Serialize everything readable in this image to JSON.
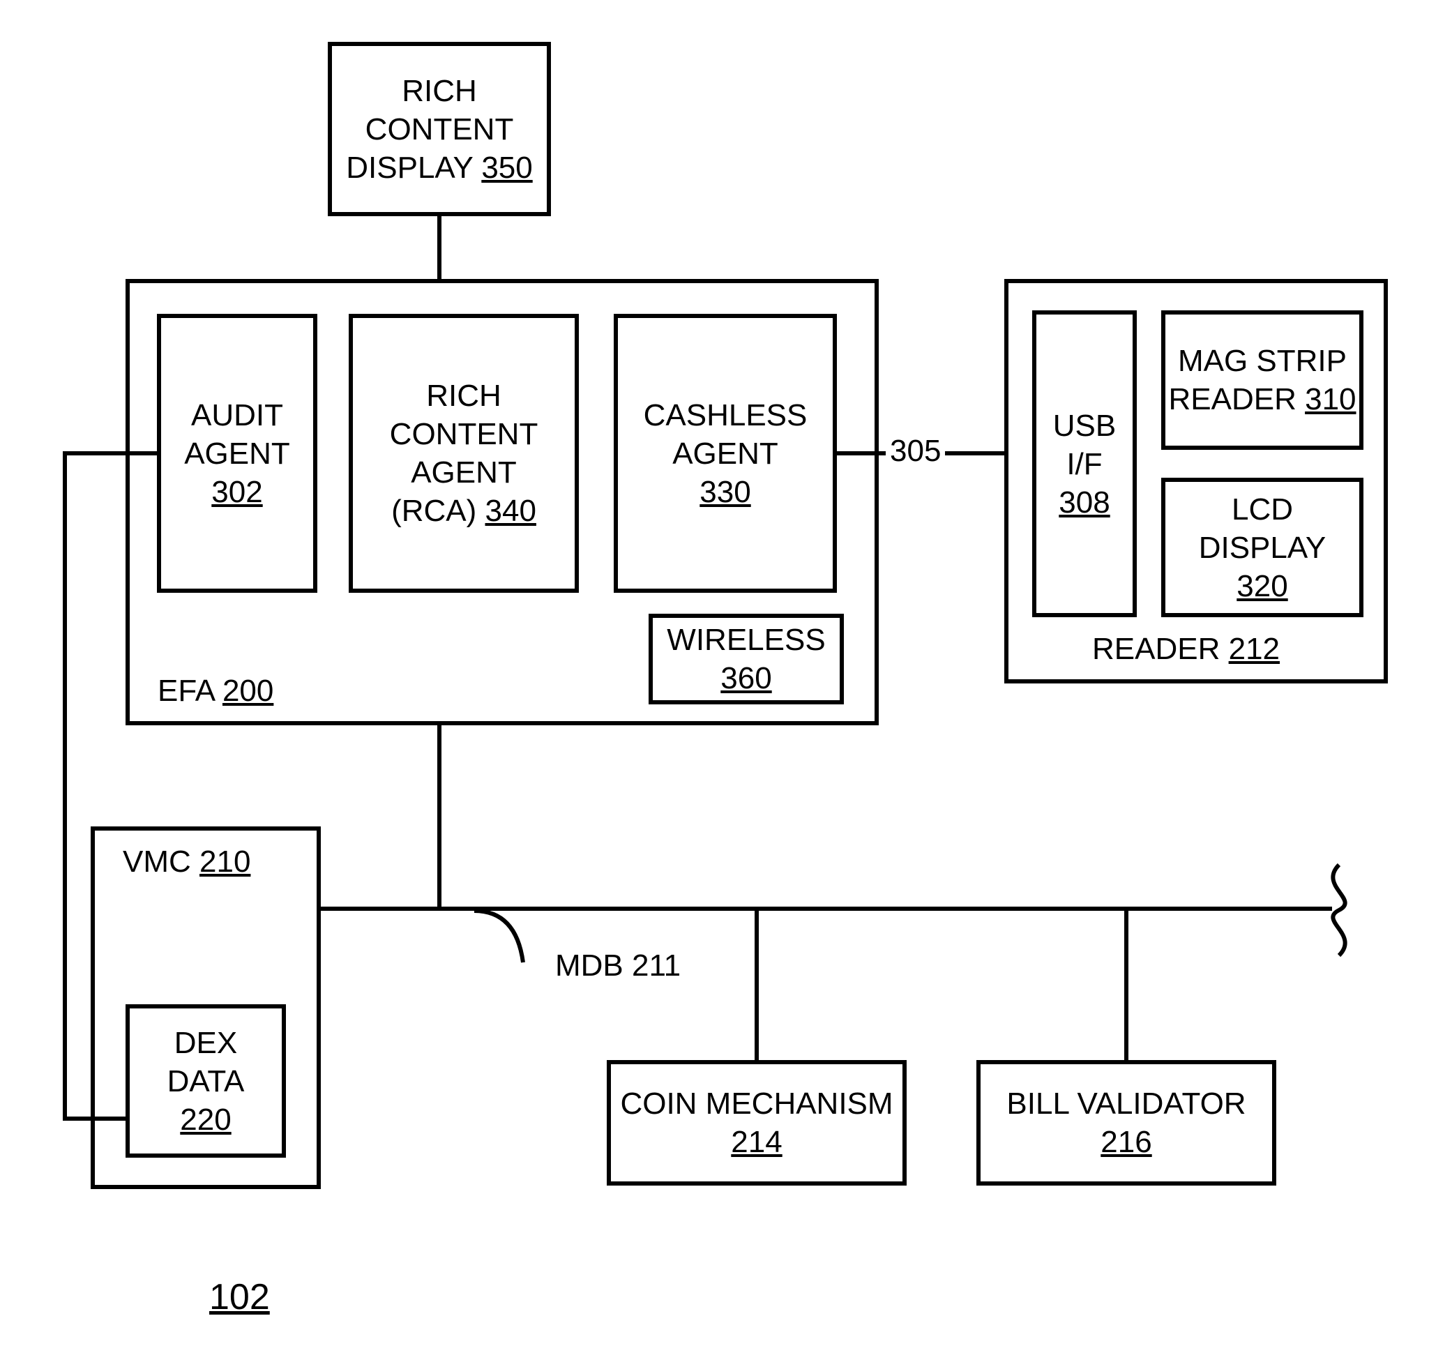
{
  "rich_content_display": {
    "line1": "RICH",
    "line2": "CONTENT",
    "line3": "DISPLAY",
    "ref": "350"
  },
  "efa": {
    "label": "EFA",
    "ref": "200"
  },
  "audit_agent": {
    "line1": "AUDIT",
    "line2": "AGENT",
    "ref": "302"
  },
  "rca": {
    "line1": "RICH",
    "line2": "CONTENT",
    "line3": "AGENT",
    "line4": "(RCA)",
    "ref": "340"
  },
  "cashless_agent": {
    "line1": "CASHLESS",
    "line2": "AGENT",
    "ref": "330"
  },
  "wireless": {
    "line1": "WIRELESS",
    "ref": "360"
  },
  "reader": {
    "label": "READER",
    "ref": "212"
  },
  "usb_if": {
    "line1": "USB",
    "line2": "I/F",
    "ref": "308"
  },
  "mag_strip": {
    "line1": "MAG STRIP",
    "line2": "READER",
    "ref": "310"
  },
  "lcd": {
    "line1": "LCD DISPLAY",
    "ref": "320"
  },
  "vmc": {
    "label": "VMC",
    "ref": "210"
  },
  "dex": {
    "line1": "DEX",
    "line2": "DATA",
    "ref": "220"
  },
  "mdb": {
    "label": "MDB 211"
  },
  "coin": {
    "line1": "COIN MECHANISM",
    "ref": "214"
  },
  "bill": {
    "line1": "BILL VALIDATOR",
    "ref": "216"
  },
  "conn_305": {
    "label": "305"
  },
  "fig_ref": {
    "ref": "102"
  }
}
